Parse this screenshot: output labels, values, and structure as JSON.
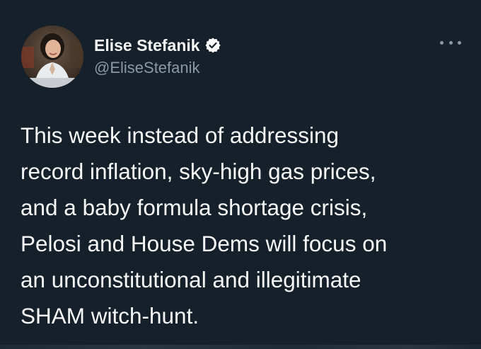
{
  "author": {
    "display_name": "Elise Stefanik",
    "handle": "@EliseStefanik",
    "verified": true,
    "avatar_icon": "profile-photo"
  },
  "tweet": {
    "lines": [
      "This week instead of addressing",
      "record inflation, sky-high gas prices,",
      "and a baby formula shortage crisis,",
      "Pelosi and House Dems will focus on",
      "an unconstitutional and illegitimate",
      "SHAM witch-hunt."
    ]
  },
  "menu": {
    "icon": "more-options-icon"
  },
  "colors": {
    "background": "#15202b",
    "text": "#f7f9f9",
    "secondary_text": "#8b98a5",
    "verified": "#ffffff"
  }
}
